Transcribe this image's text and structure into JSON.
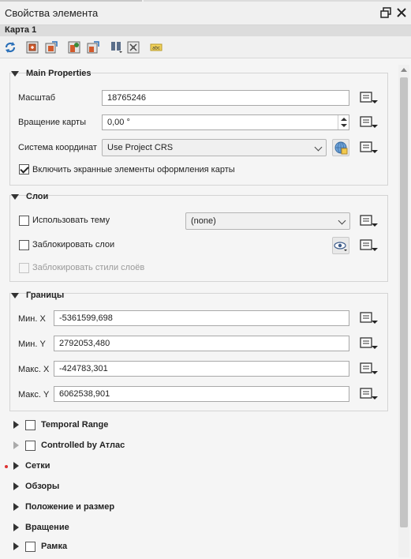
{
  "window": {
    "title": "Свойства элемента"
  },
  "item": {
    "name": "Карта 1"
  },
  "toolbar": {
    "tools": [
      "refresh-icon",
      "map-set-extent-icon",
      "map-view-extent-icon",
      "map-center-icon",
      "map-view-center-icon",
      "bookmarks-icon",
      "labels-settings-icon",
      "abc-label-icon"
    ]
  },
  "main": {
    "header": "Main Properties",
    "scale_label": "Масштаб",
    "scale_value": "18765246",
    "rotation_label": "Вращение карты",
    "rotation_value": "0,00 °",
    "crs_label": "Система координат",
    "crs_value": "Use Project CRS",
    "decorations_label": "Включить экранные элементы оформления карты",
    "decorations_checked": true
  },
  "layers": {
    "header": "Слои",
    "use_theme_label": "Использовать тему",
    "theme_value": "(none)",
    "lock_layers_label": "Заблокировать слои",
    "lock_styles_label": "Заблокировать стили слоёв"
  },
  "extents": {
    "header": "Границы",
    "xmin_label": "Мин. X",
    "xmin_value": "-5361599,698",
    "ymin_label": "Мин. Y",
    "ymin_value": "2792053,480",
    "xmax_label": "Макс. X",
    "xmax_value": "-424783,301",
    "ymax_label": "Макс. Y",
    "ymax_value": "6062538,901"
  },
  "collapsed": {
    "temporal": "Temporal Range",
    "atlas": "Controlled by Атлас",
    "grids": "Сетки",
    "overviews": "Обзоры",
    "position": "Положение и размер",
    "rotation": "Вращение",
    "frame": "Рамка"
  }
}
